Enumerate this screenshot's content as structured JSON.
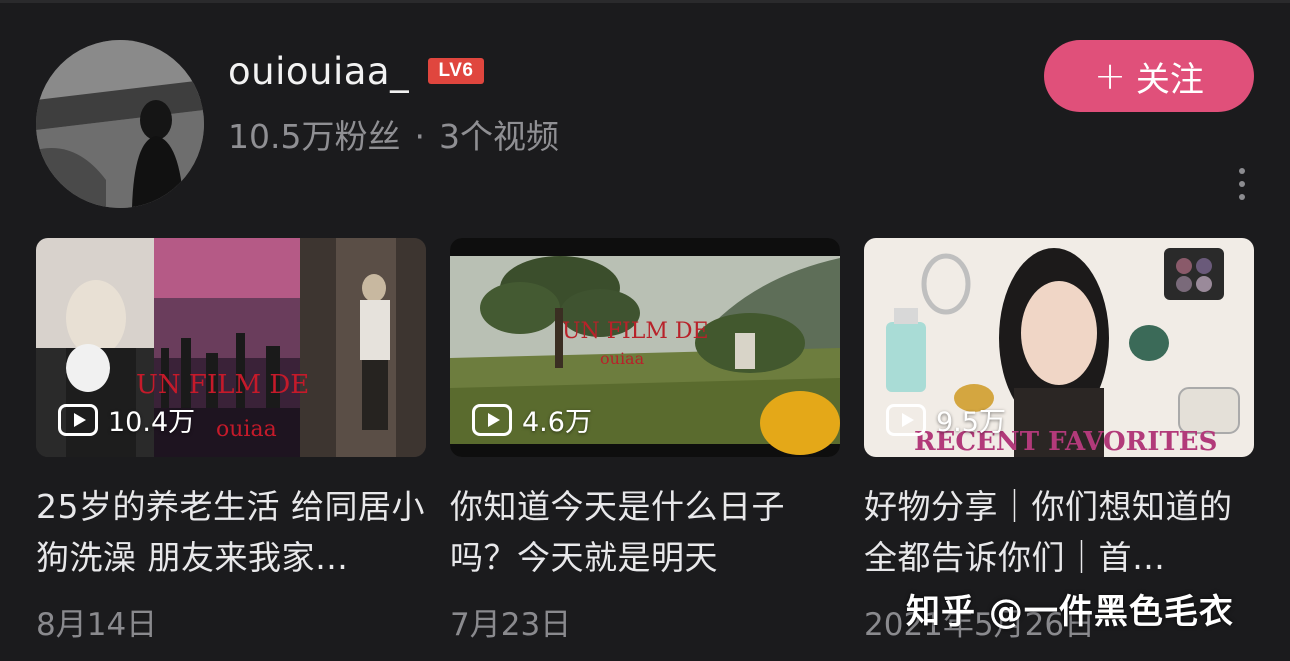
{
  "profile": {
    "username": "ouiouiaa_",
    "level": "LV6",
    "followers": "10.5万粉丝",
    "separator": "·",
    "video_count": "3个视频",
    "follow_plus": "+",
    "follow_label": "关注"
  },
  "videos": [
    {
      "views": "10.4万",
      "title": "25岁的养老生活 给同居小狗洗澡 朋友来我家…",
      "date": "8月14日",
      "overlay_text": "UN FILM DE",
      "overlay_sub": "ouiaa"
    },
    {
      "views": "4.6万",
      "title": "你知道今天是什么日子吗？今天就是明天",
      "date": "7月23日",
      "overlay_text": "UN FILM DE",
      "overlay_sub": "ouiaa"
    },
    {
      "views": "9.5万",
      "title": "好物分享｜你们想知道的 全都告诉你们｜首…",
      "date": "2021年5月26日",
      "overlay_text": "RECENT FAVORITES"
    }
  ],
  "watermark": "知乎 @一件黑色毛衣",
  "colors": {
    "background": "#1b1b1d",
    "follow_button": "#e0507a",
    "level_badge": "#e0463e",
    "muted_text": "#8f8f93"
  },
  "icons": {
    "play": "play-icon",
    "more": "more-vertical-icon"
  }
}
